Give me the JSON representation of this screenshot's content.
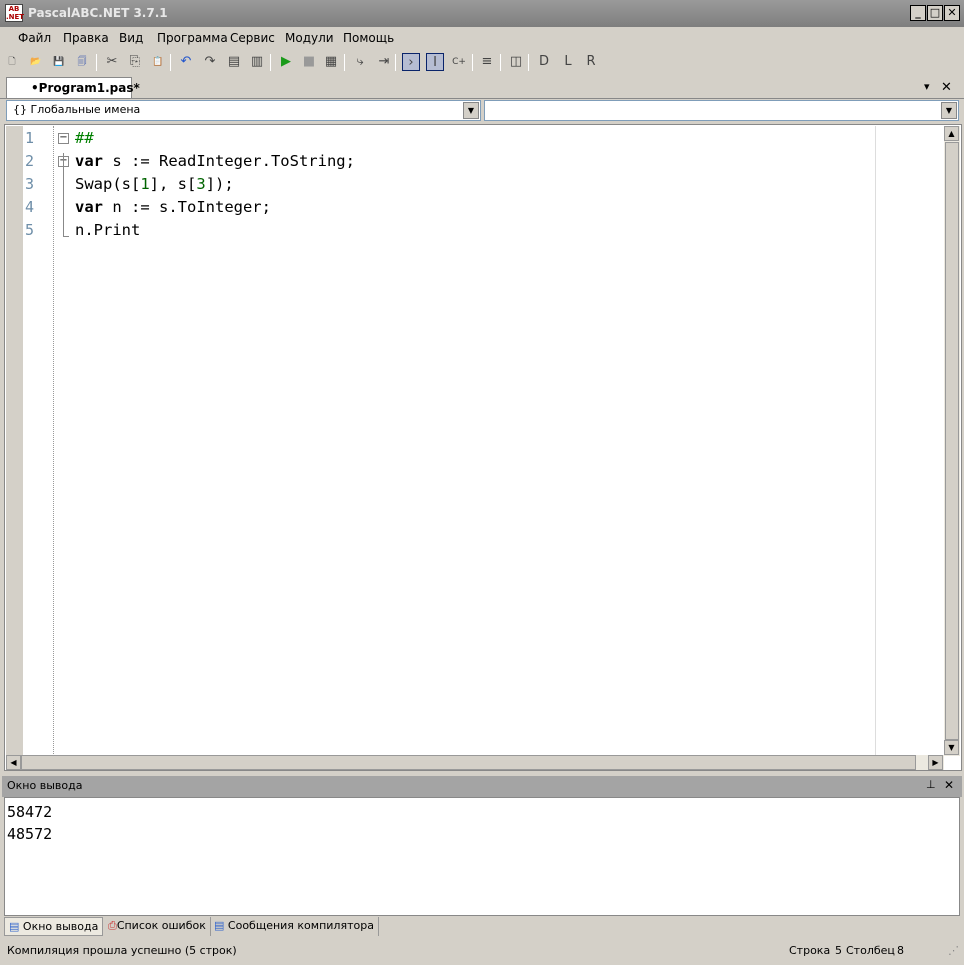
{
  "window": {
    "title": "PascalABC.NET 3.7.1",
    "icon": "pascalabc-icon",
    "min": "_",
    "max": "□",
    "close": "✕"
  },
  "menu": [
    "Файл",
    "Правка",
    "Вид",
    "Программа",
    "Сервис",
    "Модули",
    "Помощь"
  ],
  "toolbar": [
    {
      "name": "new-file-icon",
      "glyph": "🗋"
    },
    {
      "name": "open-folder-icon",
      "glyph": "📂"
    },
    {
      "name": "save-icon",
      "glyph": "💾"
    },
    {
      "name": "save-all-icon",
      "glyph": "🗐"
    },
    {
      "name": "cut-icon",
      "glyph": "✂"
    },
    {
      "name": "copy-icon",
      "glyph": "⎘"
    },
    {
      "name": "paste-icon",
      "glyph": "📋"
    },
    {
      "name": "undo-icon",
      "glyph": "↶"
    },
    {
      "name": "redo-icon",
      "glyph": "↷"
    },
    {
      "name": "find-icon",
      "glyph": "▤"
    },
    {
      "name": "replace-icon",
      "glyph": "▥"
    },
    {
      "name": "run-icon",
      "glyph": "▶"
    },
    {
      "name": "stop-icon",
      "glyph": "■"
    },
    {
      "name": "compile-icon",
      "glyph": "▦"
    },
    {
      "name": "step-into-icon",
      "glyph": "⤷"
    },
    {
      "name": "step-over-icon",
      "glyph": "⇥"
    },
    {
      "name": "console-icon",
      "glyph": "›"
    },
    {
      "name": "text-icon",
      "glyph": "I"
    },
    {
      "name": "convert-icon",
      "glyph": "C+"
    },
    {
      "name": "format-icon",
      "glyph": "≡"
    },
    {
      "name": "code-template-icon",
      "glyph": "◫"
    },
    {
      "name": "form-d-icon",
      "glyph": "D"
    },
    {
      "name": "form-l-icon",
      "glyph": "L"
    },
    {
      "name": "form-r-icon",
      "glyph": "R"
    }
  ],
  "tab": {
    "label": "•Program1.pas*"
  },
  "tab_controls": {
    "dropdown": "▾",
    "close": "✕"
  },
  "scope_select": {
    "value": "{} Глобальные имена"
  },
  "member_select": {
    "value": ""
  },
  "editor": {
    "line_numbers": [
      "1",
      "2",
      "3",
      "4",
      "5"
    ],
    "lines": [
      [
        {
          "t": "##",
          "c": "cm"
        }
      ],
      [
        {
          "t": "var",
          "c": "kw"
        },
        {
          "t": " s := ReadInteger.ToString;",
          "c": ""
        }
      ],
      [
        {
          "t": "Swap(s[",
          "c": ""
        },
        {
          "t": "1",
          "c": "num"
        },
        {
          "t": "], s[",
          "c": ""
        },
        {
          "t": "3",
          "c": "num"
        },
        {
          "t": "]);",
          "c": ""
        }
      ],
      [
        {
          "t": "var",
          "c": "kw"
        },
        {
          "t": " n := s.ToInteger;",
          "c": ""
        }
      ],
      [
        {
          "t": "n.Print",
          "c": ""
        }
      ]
    ]
  },
  "output": {
    "title": "Окно вывода",
    "pin": "📌",
    "close": "✕",
    "lines": [
      "58472",
      "48572"
    ]
  },
  "bottom_tabs": [
    "Окно вывода",
    "Список ошибок",
    "Сообщения компилятора"
  ],
  "status": {
    "message": "Компиляция прошла успешно (5 строк)",
    "row_label": "Строка",
    "row": "5",
    "col_label": "Столбец",
    "col": "8"
  }
}
